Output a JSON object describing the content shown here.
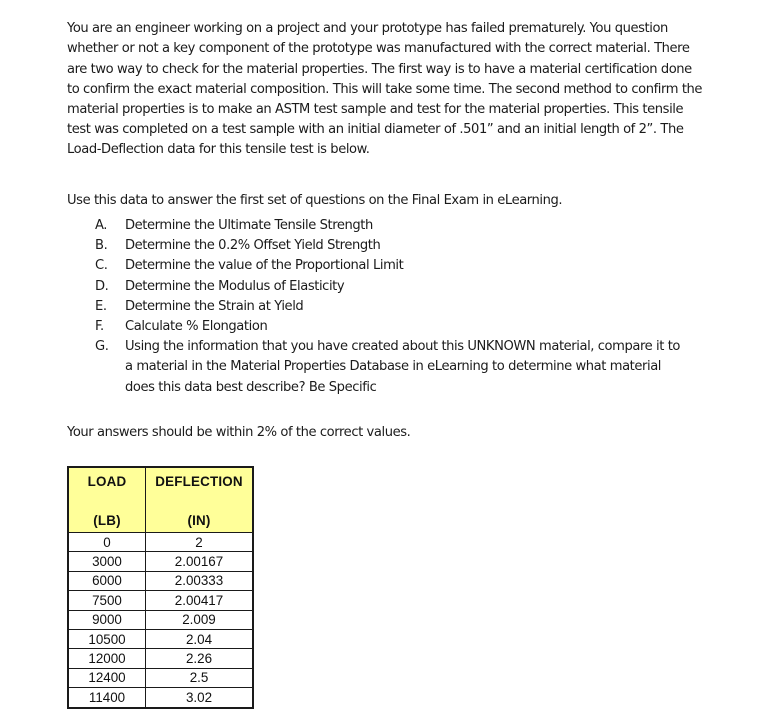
{
  "document": {
    "intro_paragraph": "You are an engineer working on a project and your prototype has failed prematurely. You question whether or not a key component of the prototype was manufactured with the correct material.  There are two way to check for the material properties.  The first way is to have a material certification done to confirm the exact material composition.  This will take some time.  The second method to confirm the material properties is to make an ASTM test sample and test for the material properties.  This tensile test was completed on a test sample with an initial diameter of .501” and an initial length of 2”.  The Load-Deflection data for this tensile test is below.",
    "instruction_line": "Use this data to answer the first set of questions on the Final Exam in eLearning.",
    "accuracy_note": "Your answers should be within 2% of the correct values.",
    "questions": [
      {
        "marker": "A.",
        "text": "Determine the Ultimate Tensile Strength"
      },
      {
        "marker": "B.",
        "text": "Determine the 0.2% Offset Yield Strength"
      },
      {
        "marker": "C.",
        "text": "Determine the value of the Proportional Limit"
      },
      {
        "marker": "D.",
        "text": "Determine the Modulus of Elasticity"
      },
      {
        "marker": "E.",
        "text": "Determine the Strain at Yield"
      },
      {
        "marker": "F.",
        "text": "Calculate % Elongation"
      },
      {
        "marker": "G.",
        "text": "Using the information that you have created about this UNKNOWN material, compare it to a material in the Material Properties Database in eLearning to determine what material does this data best describe?  Be Specific"
      }
    ]
  },
  "chart_data": {
    "type": "table",
    "title": "",
    "header_background": "#FFFF99",
    "columns": [
      {
        "name": "LOAD",
        "unit": "(LB)"
      },
      {
        "name": "DEFLECTION",
        "unit": "(IN)"
      }
    ],
    "categories": [
      "0",
      "3000",
      "6000",
      "7500",
      "9000",
      "10500",
      "12000",
      "12400",
      "11400"
    ],
    "series": [
      {
        "name": "LOAD (LB)",
        "values": [
          0,
          3000,
          6000,
          7500,
          9000,
          10500,
          12000,
          12400,
          11400
        ]
      },
      {
        "name": "DEFLECTION (IN)",
        "values": [
          2,
          2.00167,
          2.00333,
          2.00417,
          2.009,
          2.04,
          2.26,
          2.5,
          3.02
        ]
      }
    ],
    "rows": [
      {
        "load": "0",
        "deflection": "2"
      },
      {
        "load": "3000",
        "deflection": "2.00167"
      },
      {
        "load": "6000",
        "deflection": "2.00333"
      },
      {
        "load": "7500",
        "deflection": "2.00417"
      },
      {
        "load": "9000",
        "deflection": "2.009"
      },
      {
        "load": "10500",
        "deflection": "2.04"
      },
      {
        "load": "12000",
        "deflection": "2.26"
      },
      {
        "load": "12400",
        "deflection": "2.5"
      },
      {
        "load": "11400",
        "deflection": "3.02"
      }
    ],
    "xlabel": "LOAD (LB)",
    "ylabel": "DEFLECTION (IN)"
  }
}
